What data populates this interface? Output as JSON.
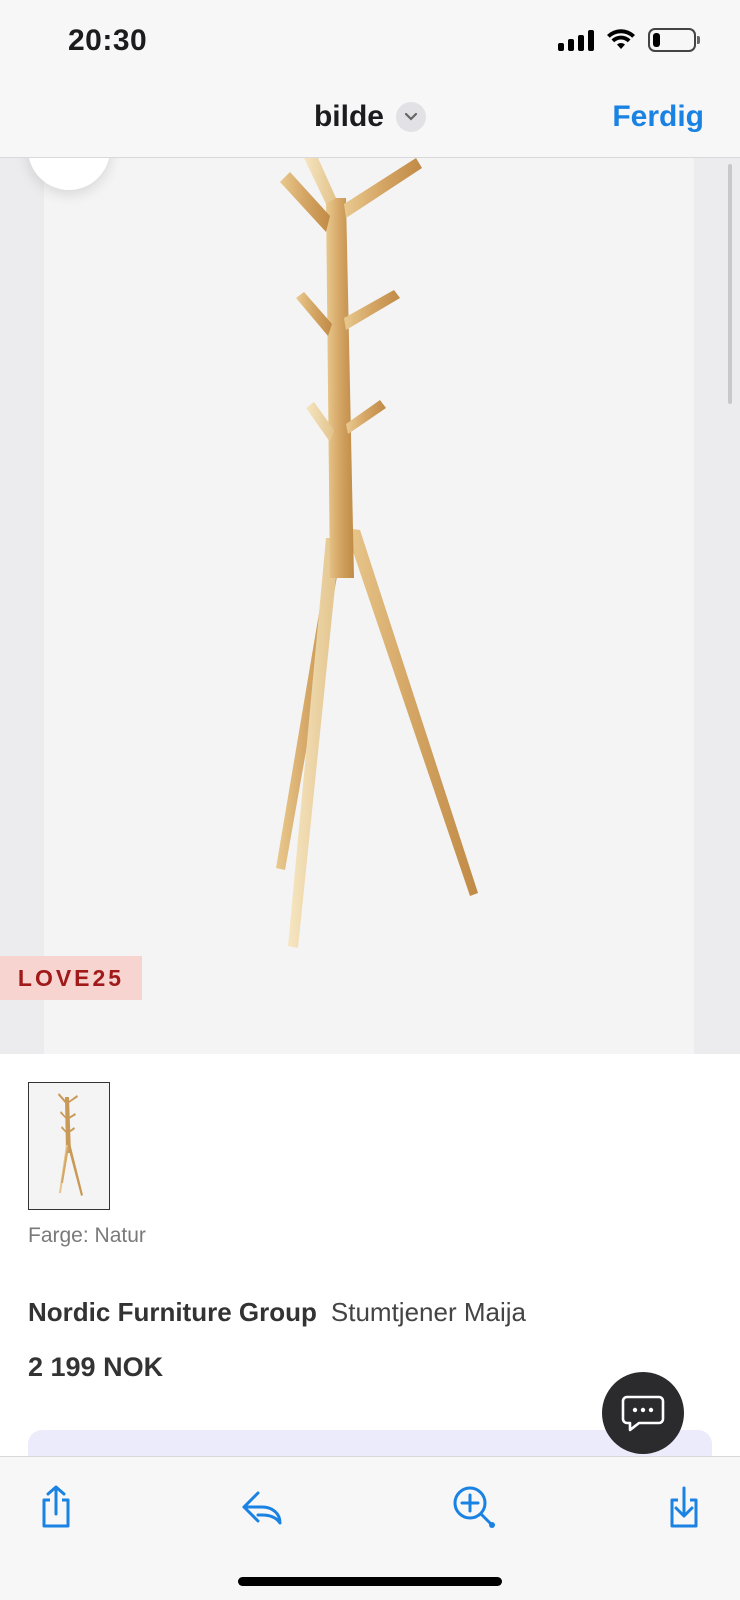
{
  "status": {
    "time": "20:30",
    "battery_level": 0.18
  },
  "nav": {
    "title": "bilde",
    "done_label": "Ferdig"
  },
  "image": {
    "promo_code": "LOVE25"
  },
  "product": {
    "color_label": "Farge: Natur",
    "brand": "Nordic Furniture Group",
    "name": "Stumtjener Maija",
    "price": "2 199 NOK"
  },
  "toolbar": {
    "icons": [
      "share-icon",
      "reply-icon",
      "zoom-in-icon",
      "download-icon"
    ]
  },
  "colors": {
    "accent": "#1a82e2",
    "promo_bg": "#f7d4d0",
    "promo_text": "#a01a1a"
  }
}
